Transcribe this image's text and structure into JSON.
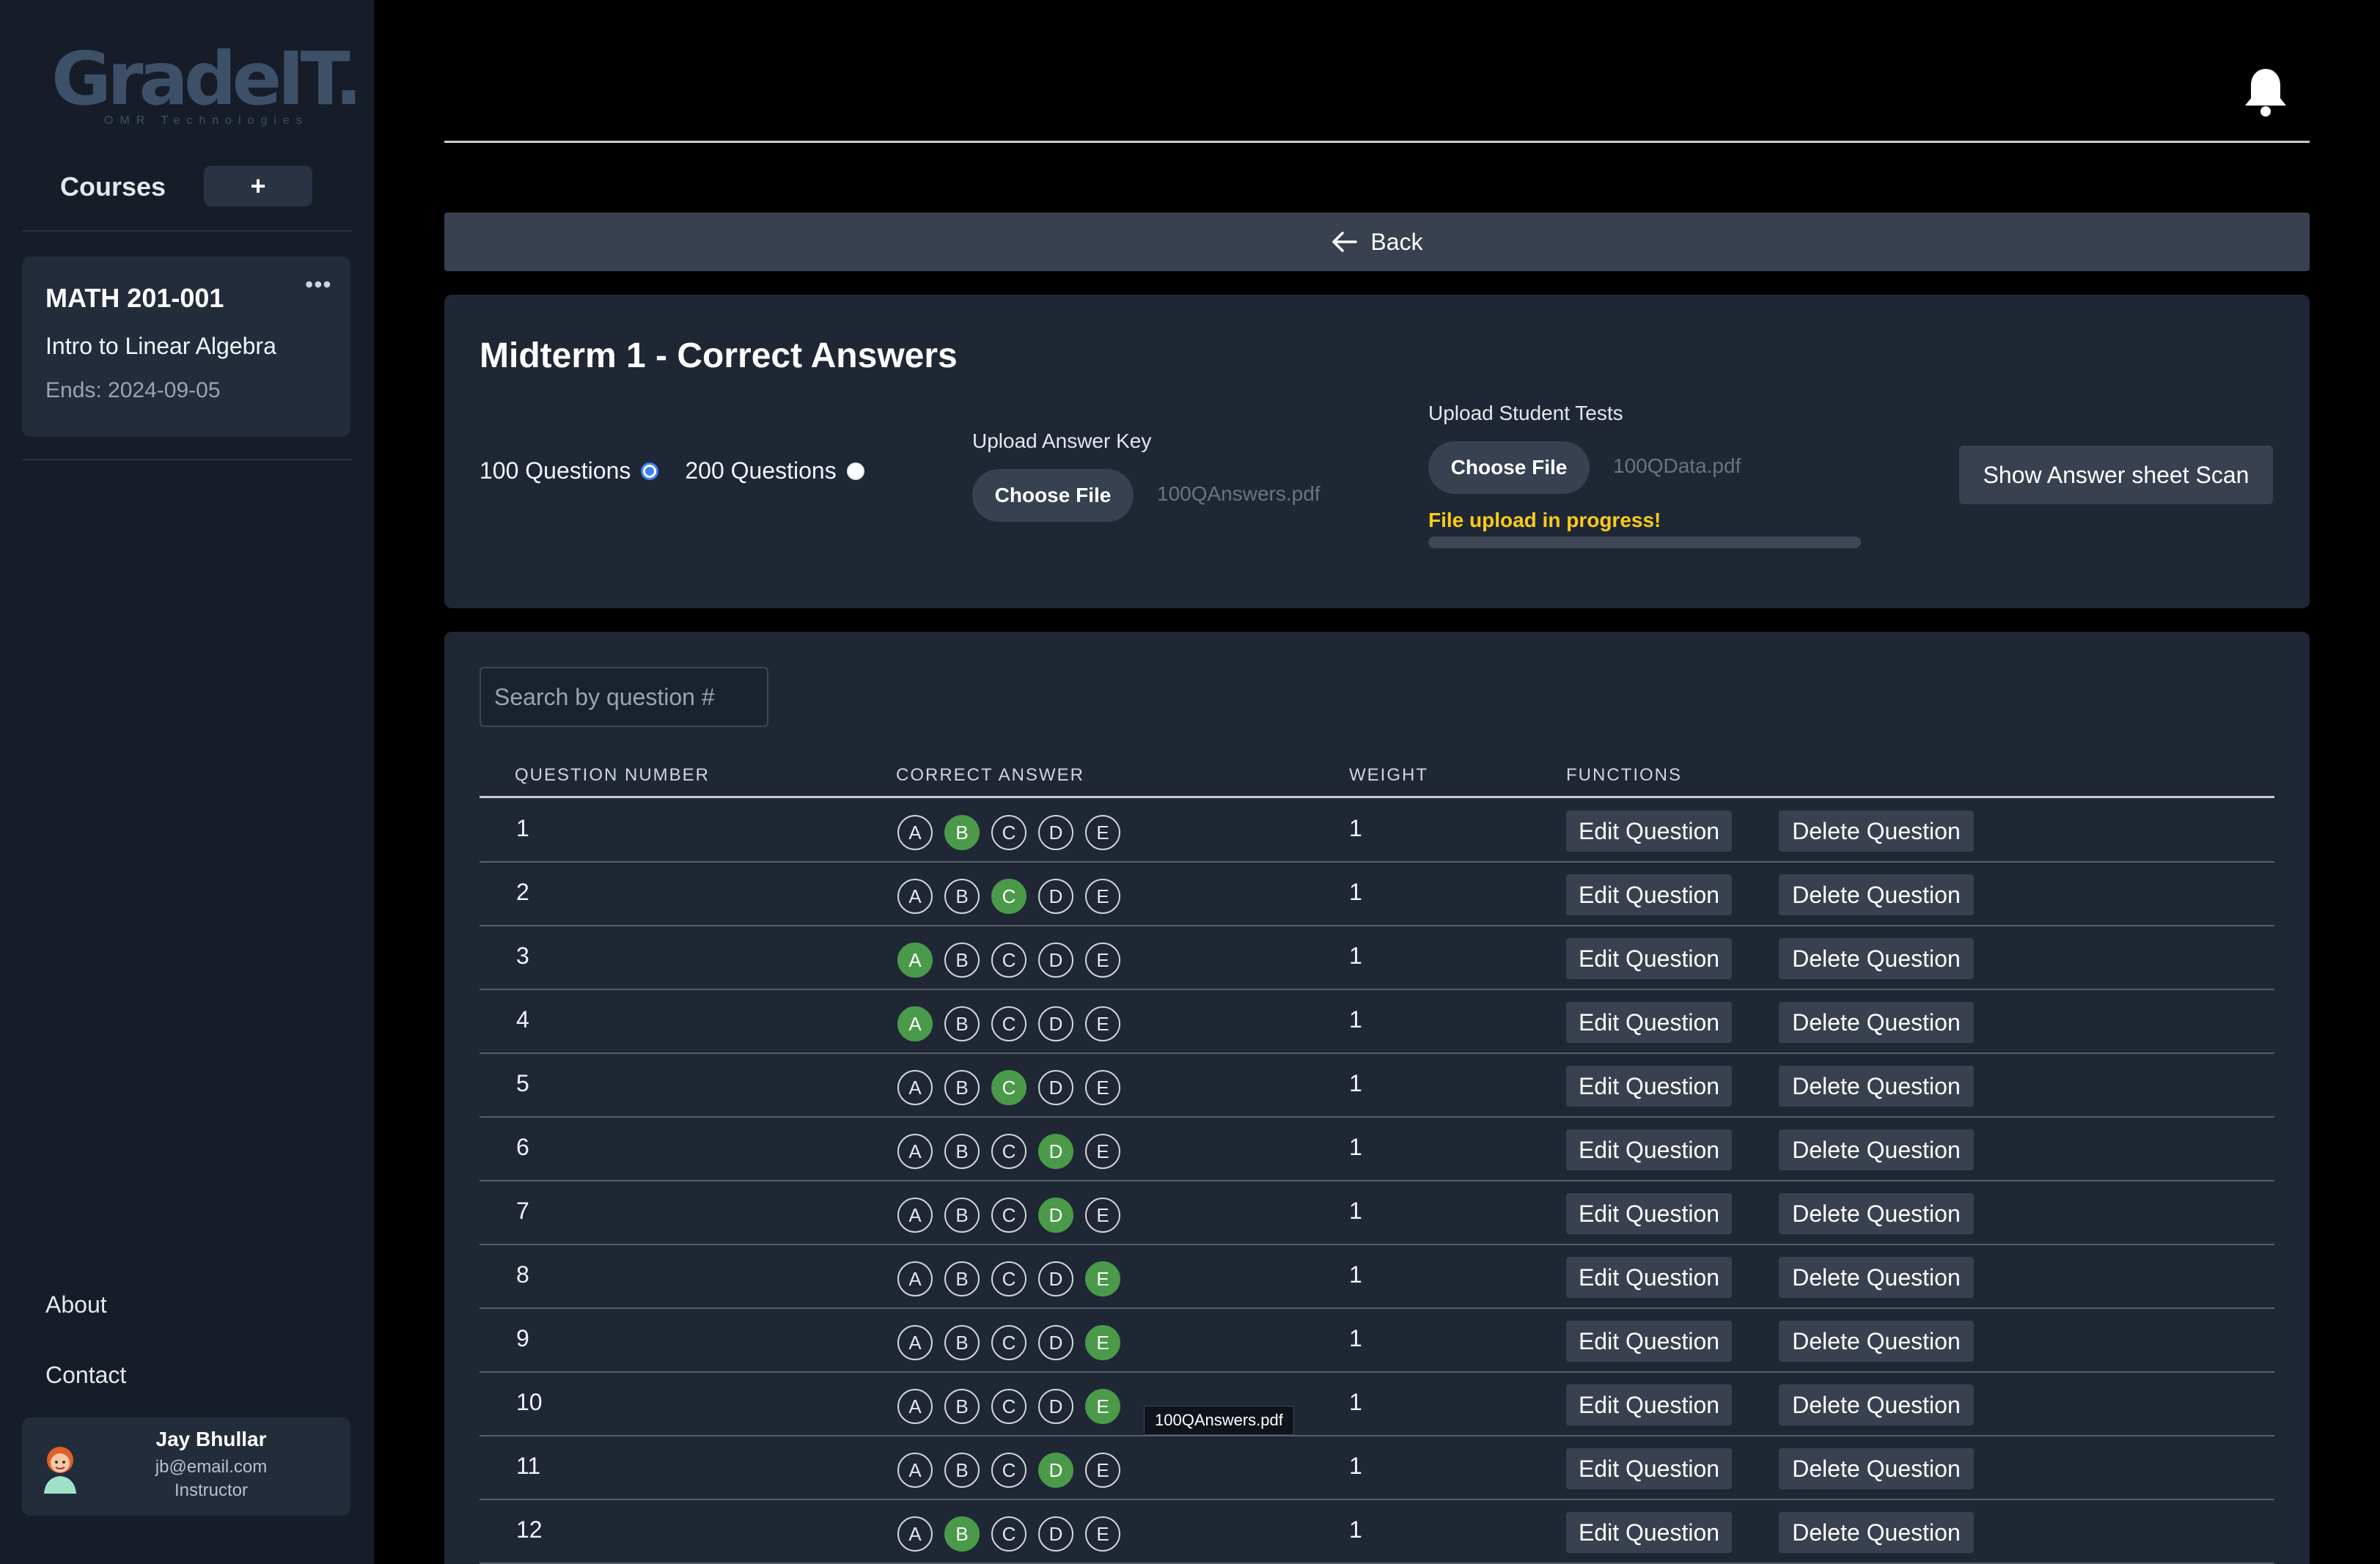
{
  "sidebar": {
    "logo_text": "GradeIT.",
    "logo_sub": "OMR Technologies",
    "courses_label": "Courses",
    "add_label": "+",
    "course": {
      "code": "MATH 201-001",
      "menu": "•••",
      "name": "Intro to Linear Algebra",
      "ends": "Ends: 2024-09-05"
    },
    "links": [
      "About",
      "Contact"
    ],
    "user": {
      "name": "Jay Bhullar",
      "email": "jb@email.com",
      "role": "Instructor"
    }
  },
  "back_label": "Back",
  "header": {
    "title": "Midterm 1 - Correct Answers",
    "options": [
      {
        "label": "100 Questions",
        "checked": true
      },
      {
        "label": "200 Questions",
        "checked": false
      }
    ],
    "answer_key": {
      "label": "Upload Answer Key",
      "button": "Choose File",
      "file": "100QAnswers.pdf"
    },
    "student_tests": {
      "label": "Upload Student Tests",
      "button": "Choose File",
      "file": "100QData.pdf",
      "status": "File upload in progress!",
      "progress": 0
    },
    "scan_button": "Show Answer sheet Scan"
  },
  "table": {
    "search_placeholder": "Search by question #",
    "columns": [
      "QUESTION NUMBER",
      "CORRECT ANSWER",
      "WEIGHT",
      "FUNCTIONS"
    ],
    "choice_letters": [
      "A",
      "B",
      "C",
      "D",
      "E"
    ],
    "edit_label": "Edit Question",
    "delete_label": "Delete Question",
    "rows": [
      {
        "num": "1",
        "answer": "B",
        "weight": "1"
      },
      {
        "num": "2",
        "answer": "C",
        "weight": "1"
      },
      {
        "num": "3",
        "answer": "A",
        "weight": "1"
      },
      {
        "num": "4",
        "answer": "A",
        "weight": "1"
      },
      {
        "num": "5",
        "answer": "C",
        "weight": "1"
      },
      {
        "num": "6",
        "answer": "D",
        "weight": "1"
      },
      {
        "num": "7",
        "answer": "D",
        "weight": "1"
      },
      {
        "num": "8",
        "answer": "E",
        "weight": "1"
      },
      {
        "num": "9",
        "answer": "E",
        "weight": "1"
      },
      {
        "num": "10",
        "answer": "E",
        "weight": "1"
      },
      {
        "num": "11",
        "answer": "D",
        "weight": "1"
      },
      {
        "num": "12",
        "answer": "B",
        "weight": "1"
      }
    ]
  },
  "tooltip": "100QAnswers.pdf",
  "colors": {
    "selected_answer": "#4a9a4a",
    "progress_text": "#facc15",
    "sidebar_bg": "#161d29",
    "panel_bg": "#1f2735"
  }
}
